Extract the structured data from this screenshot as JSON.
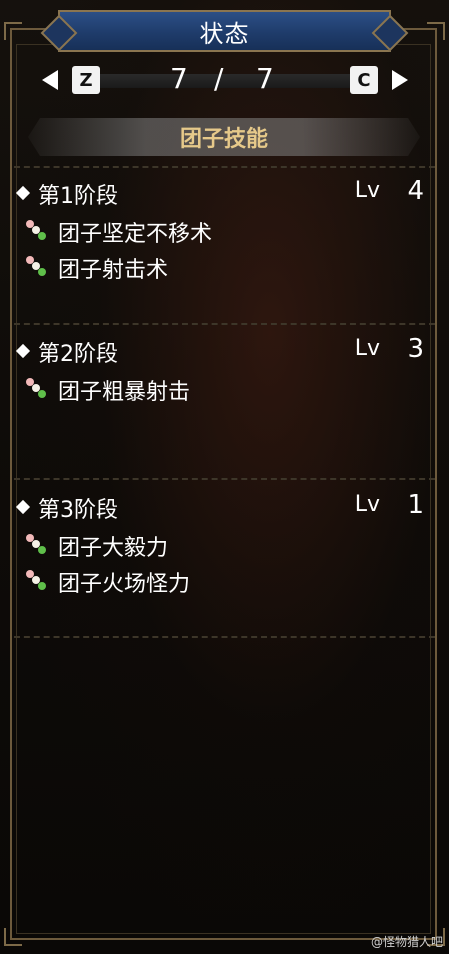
{
  "window": {
    "title": "状态"
  },
  "nav": {
    "prev_key": "Z",
    "next_key": "C",
    "current_page": "7",
    "separator": "/",
    "total_pages": "7"
  },
  "section": {
    "title": "团子技能"
  },
  "stages": [
    {
      "title": "第1阶段",
      "lv_label": "Lv",
      "lv_value": "4",
      "skills": [
        "团子坚定不移术",
        "团子射击术"
      ]
    },
    {
      "title": "第2阶段",
      "lv_label": "Lv",
      "lv_value": "3",
      "skills": [
        "团子粗暴射击"
      ]
    },
    {
      "title": "第3阶段",
      "lv_label": "Lv",
      "lv_value": "1",
      "skills": [
        "团子大毅力",
        "团子火场怪力"
      ]
    }
  ],
  "watermark": {
    "text": "@怪物猎人吧"
  },
  "colors": {
    "title_banner": "#1f3c6b",
    "section_title": "#e6c98a",
    "frame": "#6d5a3c"
  }
}
